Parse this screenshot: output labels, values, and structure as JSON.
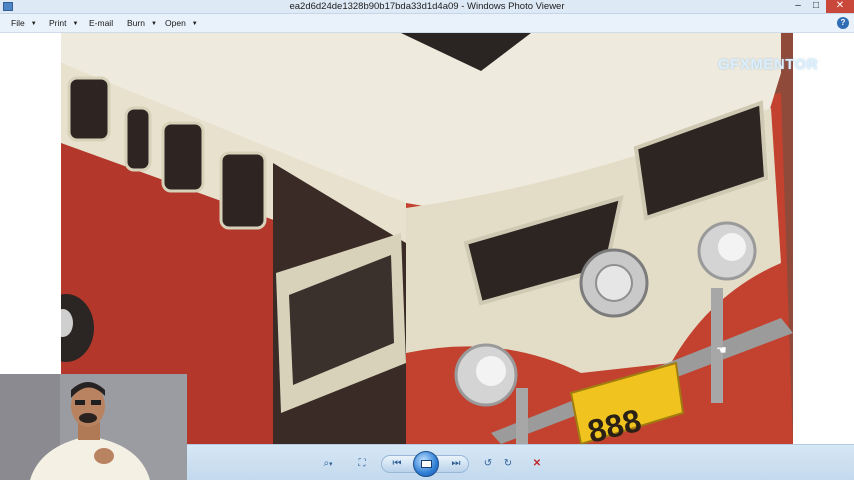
{
  "window": {
    "title": "ea2d6d24de1328b90b17bda33d1d4a09 - Windows Photo Viewer",
    "min_glyph": "–",
    "max_glyph": "□",
    "close_glyph": "✕"
  },
  "menu": {
    "items": [
      {
        "label": "File",
        "has_dropdown": true
      },
      {
        "label": "Print",
        "has_dropdown": true
      },
      {
        "label": "E-mail",
        "has_dropdown": false
      },
      {
        "label": "Burn",
        "has_dropdown": true
      },
      {
        "label": "Open",
        "has_dropdown": true
      }
    ],
    "dropdown_glyph": "▼",
    "help_glyph": "?"
  },
  "photo": {
    "subject": "van-illustration",
    "license_plate": "888"
  },
  "overlay": {
    "watermark": "GFXMENTOR"
  },
  "toolbar": {
    "zoom_glyph": "⌕",
    "zoom_dropdown_glyph": "▾",
    "actual_size_glyph": "⛶",
    "previous_glyph": "⏮",
    "next_glyph": "⏭",
    "rotate_ccw_glyph": "↺",
    "rotate_cw_glyph": "↻",
    "delete_glyph": "✕"
  },
  "colors": {
    "titlebar": "#dde9f5",
    "menubar": "#e9f1fa",
    "toolbar": "#c3d9ee",
    "close_button": "#c9473b",
    "delete_icon": "#c0282a",
    "van_red": "#b3372a",
    "van_cream": "#e8e4d3",
    "plate_yellow": "#f0c31e"
  }
}
